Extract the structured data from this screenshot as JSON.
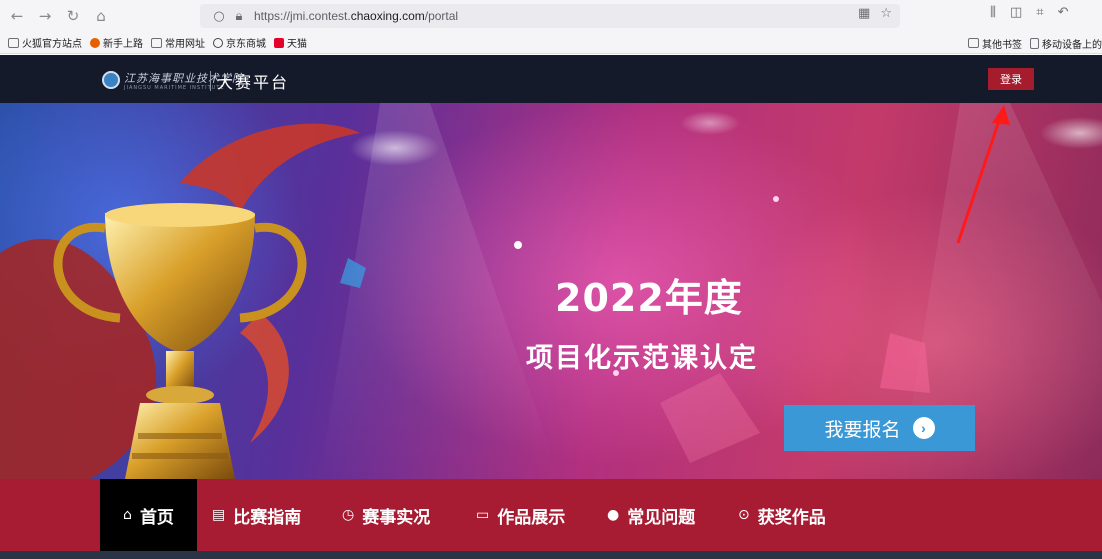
{
  "browser": {
    "url_prefix": "https://jmi.contest.",
    "url_domain": "chaoxing.com",
    "url_path": "/portal"
  },
  "bookmarks": {
    "items": [
      {
        "label": "火狐官方站点",
        "icon": "folder-icon"
      },
      {
        "label": "新手上路",
        "icon": "firefox-icon"
      },
      {
        "label": "常用网址",
        "icon": "folder-icon"
      },
      {
        "label": "京东商城",
        "icon": "globe-icon"
      },
      {
        "label": "天猫",
        "icon": "tmall-icon"
      }
    ],
    "right": [
      {
        "label": "其他书签",
        "icon": "folder-icon"
      },
      {
        "label": "移动设备上的",
        "icon": "mobile-icon"
      }
    ]
  },
  "header": {
    "logo_script": "江苏海事职业技术学院",
    "logo_sub": "JIANGSU MARITIME INSTITUTE",
    "title": "大赛平台",
    "login_label": "登录"
  },
  "hero": {
    "title": "2022年度",
    "subtitle": "项目化示范课认定",
    "signup_label": "我要报名"
  },
  "nav": {
    "items": [
      {
        "label": "首页",
        "icon": "home-icon"
      },
      {
        "label": "比赛指南",
        "icon": "book-icon"
      },
      {
        "label": "赛事实况",
        "icon": "live-icon"
      },
      {
        "label": "作品展示",
        "icon": "monitor-icon"
      },
      {
        "label": "常见问题",
        "icon": "chat-icon"
      },
      {
        "label": "获奖作品",
        "icon": "play-icon"
      }
    ]
  },
  "colors": {
    "header_bg": "#151a2b",
    "login_red": "#a51d2d",
    "nav_red": "#a71c33",
    "signup_blue": "#3a98d6"
  }
}
